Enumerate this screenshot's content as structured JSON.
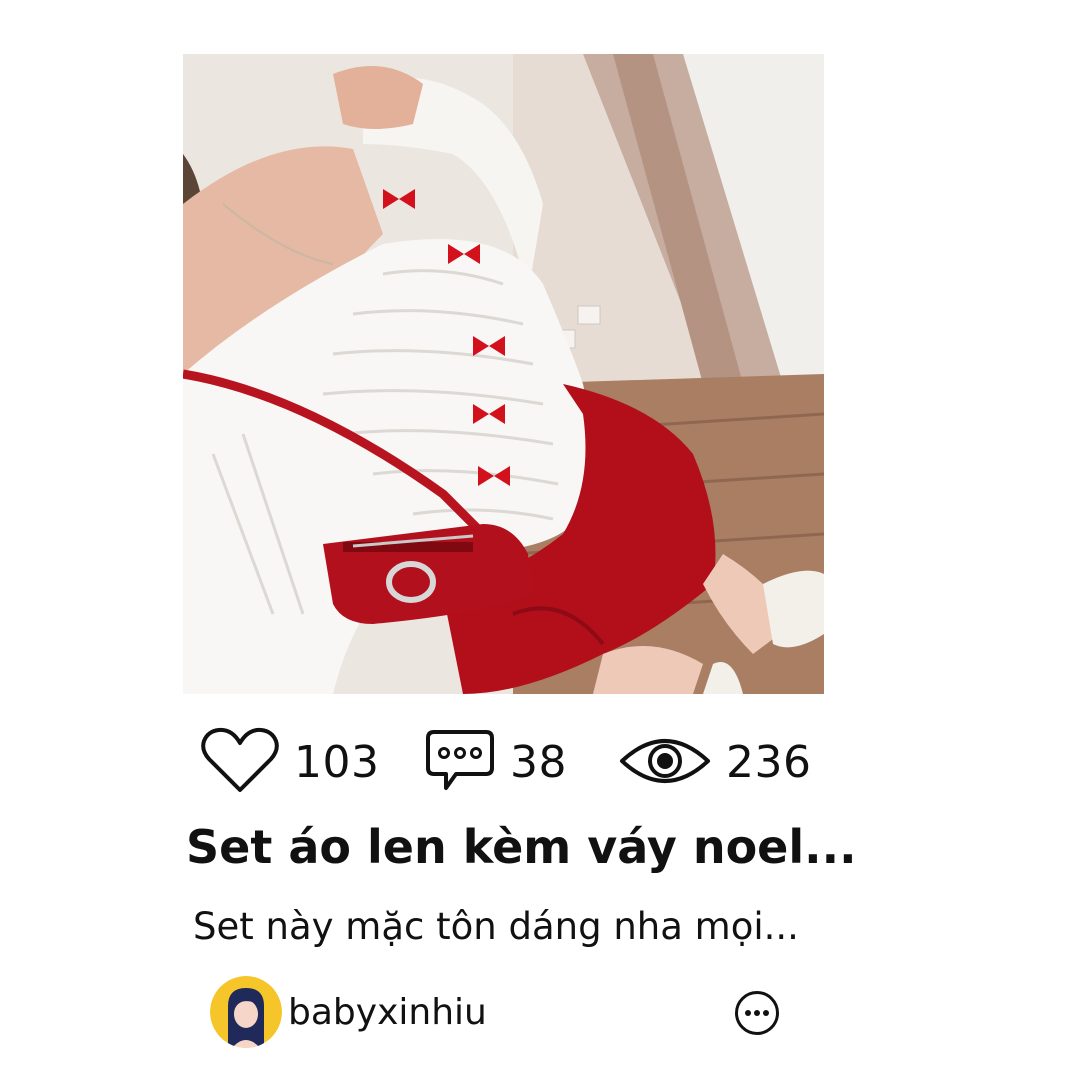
{
  "post": {
    "image": {
      "description_icon": "photo"
    },
    "stats": {
      "likes": "103",
      "comments": "38",
      "views": "236"
    },
    "title": "Set áo len kèm váy noel...",
    "description": "Set này mặc tôn dáng nha mọi...",
    "author": {
      "username": "babyxinhiu"
    }
  },
  "colors": {
    "text": "#111111",
    "avatar_bg": "#f5c52a",
    "accent_red": "#c8141c"
  },
  "icons": [
    "heart-icon",
    "comment-icon",
    "eye-icon",
    "more-icon"
  ]
}
